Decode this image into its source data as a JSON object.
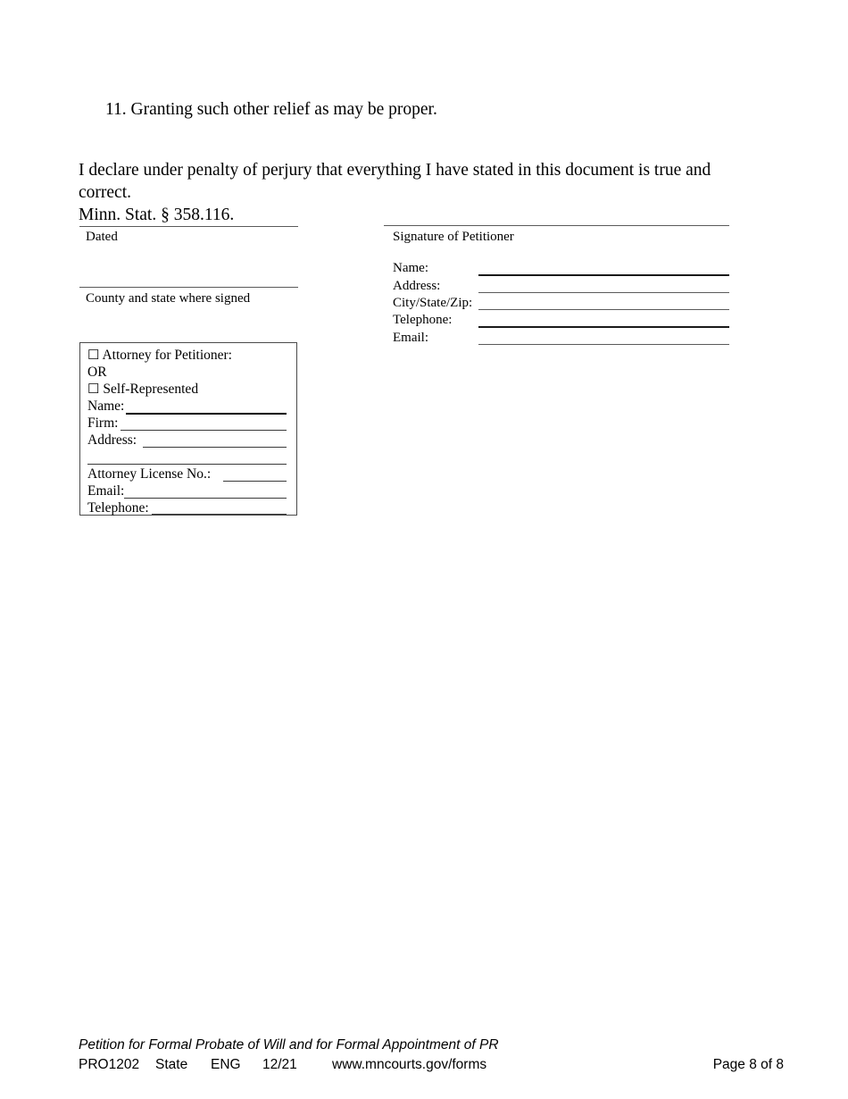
{
  "document": {
    "numbered_item": "11. Granting such other relief as may be proper.",
    "declaration_line_1": "I declare under penalty of perjury that everything I have stated in this document is true and correct.",
    "declaration_line_2": "Minn. Stat. § 358.116."
  },
  "signature_block": {
    "left": {
      "dated_label": "Dated",
      "county_label": "County and state where signed"
    },
    "right": {
      "signature_label": "Signature of Petitioner",
      "fields": [
        {
          "label": "Name:",
          "value": ""
        },
        {
          "label": "Address:",
          "value": ""
        },
        {
          "label": "City/State/Zip:",
          "value": ""
        },
        {
          "label": "Telephone:",
          "value": ""
        },
        {
          "label": "Email:",
          "value": ""
        }
      ]
    }
  },
  "attorney_box": {
    "checkbox_glyph": "☐",
    "attorney_option": "Attorney for Petitioner:",
    "or_label": "OR",
    "self_represented_option": "Self-Represented",
    "fields": [
      {
        "label": "Name:",
        "value": ""
      },
      {
        "label": "Firm:",
        "value": ""
      },
      {
        "label": "Address:",
        "value": ""
      },
      {
        "label": "",
        "value": ""
      },
      {
        "label": "Attorney License No.:",
        "value": ""
      },
      {
        "label": "Email:",
        "value": ""
      },
      {
        "label": "Telephone:",
        "value": ""
      }
    ]
  },
  "footer": {
    "title": "Petition for Formal Probate of Will and for Formal Appointment of PR",
    "form_number": "PRO1202",
    "scope": "State",
    "language": "ENG",
    "revision_date": "12/21",
    "website": "www.mncourts.gov/forms",
    "page_label": "Page 8 of 8"
  }
}
